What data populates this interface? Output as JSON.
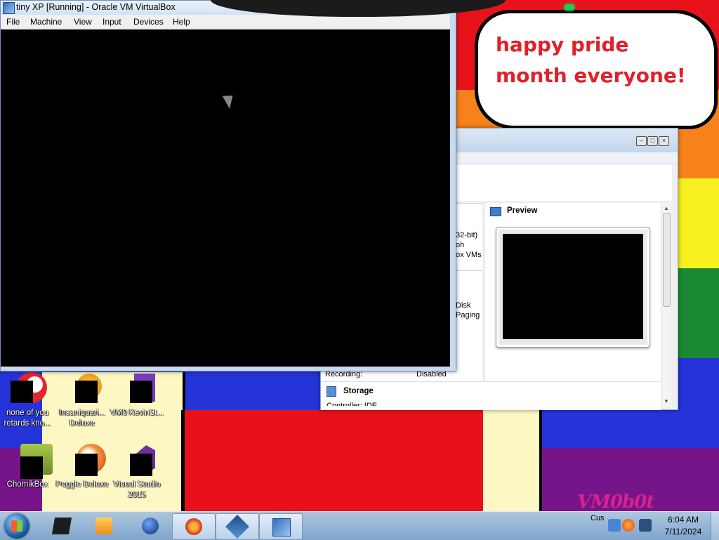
{
  "wallpaper": {
    "bubble_text": "happy pride month everyone!",
    "signature": "VM0b0t"
  },
  "desktop_icons": [
    {
      "label": "none of you retards kno..."
    },
    {
      "label": "Insaniquari... Deluxe"
    },
    {
      "label": "VM0 KevinSt..."
    },
    {
      "label": "ChomikBox"
    },
    {
      "label": "Peggle Deluxe"
    },
    {
      "label": "Visual Studio 2015"
    }
  ],
  "vm_window": {
    "title": "tiny XP [Running] - Oracle VM VirtualBox",
    "menu": [
      "File",
      "Machine",
      "View",
      "Input",
      "Devices",
      "Help"
    ]
  },
  "manager_window": {
    "partial_texts": [
      "32-bit)",
      "oh",
      "ox VMs",
      "Disk",
      "Paging"
    ],
    "recording_label": "Recording:",
    "recording_value": "Disabled",
    "preview_header": "Preview",
    "storage_header": "Storage",
    "storage_partial": "Controller: IDE"
  },
  "taskbar": {
    "tray_text": "Cus",
    "clock_time": "6:04 AM",
    "clock_date": "7/11/2024"
  },
  "colors": {
    "pride_stripes": [
      "#e8121b",
      "#f7821c",
      "#f7f21f",
      "#1a8b32",
      "#2534d8",
      "#76148a"
    ],
    "vm_screen": "#000000"
  }
}
